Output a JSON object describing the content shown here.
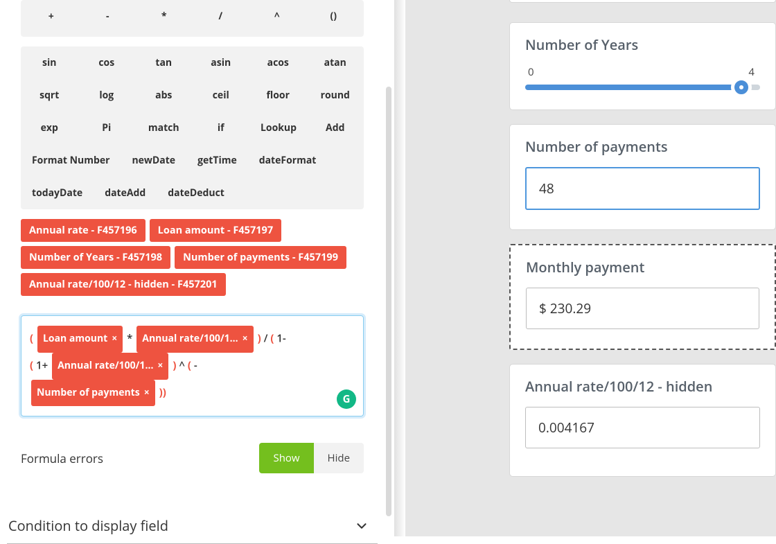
{
  "operators": [
    "+",
    "-",
    "*",
    "/",
    "^",
    "()"
  ],
  "functions_row1": [
    "sin",
    "cos",
    "tan",
    "asin",
    "acos",
    "atan"
  ],
  "functions_row2": [
    "sqrt",
    "log",
    "abs",
    "ceil",
    "floor",
    "round"
  ],
  "functions_row3": [
    "exp",
    "Pi",
    "match",
    "if",
    "Lookup",
    "Add"
  ],
  "functions_row4": [
    "Format Number",
    "newDate",
    "getTime",
    "dateFormat"
  ],
  "functions_row5": [
    "todayDate",
    "dateAdd",
    "dateDeduct"
  ],
  "field_chips": [
    "Annual rate - F457196",
    "Loan amount - F457197",
    "Number of Years - F457198",
    "Number of payments - F457199",
    "Annual rate/100/12 - hidden - F457201"
  ],
  "formula": {
    "chip1": "Loan amount",
    "chip2": "Annual rate/100/1…",
    "chip3": "Annual rate/100/1…",
    "chip4": "Number of payments",
    "g_badge": "G"
  },
  "errors": {
    "label": "Formula errors",
    "show": "Show",
    "hide": "Hide"
  },
  "condition_label": "Condition to display field",
  "preview": {
    "years": {
      "label": "Number of Years",
      "min": "0",
      "value": "4"
    },
    "num_payments": {
      "label": "Number of payments",
      "value": "48"
    },
    "monthly": {
      "label": "Monthly payment",
      "value": "$ 230.29"
    },
    "hidden_rate": {
      "label": "Annual rate/100/12 - hidden",
      "value": "0.004167"
    }
  },
  "chart_data": null
}
